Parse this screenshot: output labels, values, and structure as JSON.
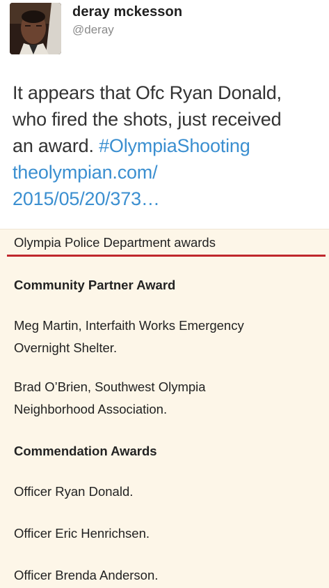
{
  "tweet": {
    "display_name": "deray mckesson",
    "handle": "@deray",
    "text_lines": [
      "It appears that Ofc Ryan Donald,",
      "who fired the shots, just received",
      "an award. "
    ],
    "hashtag": "#OlympiaShooting",
    "link_lines": [
      "theolympian.com/",
      "2015/05/20/373…"
    ]
  },
  "article": {
    "title": "Olympia Police Department awards",
    "sections": [
      {
        "heading": "Community Partner Award"
      },
      {
        "entry": [
          "Meg Martin, Interfaith Works Emergency",
          "Overnight Shelter."
        ]
      },
      {
        "entry": [
          "Brad O’Brien, Southwest Olympia",
          "Neighborhood Association."
        ]
      },
      {
        "heading": "Commendation Awards"
      },
      {
        "entry": [
          "Officer Ryan Donald."
        ]
      },
      {
        "entry": [
          "Officer Eric Henrichsen."
        ]
      },
      {
        "entry": [
          "Officer Brenda Anderson."
        ]
      }
    ]
  },
  "colors": {
    "link": "#3b8fd0",
    "rule": "#c0282d",
    "article_bg": "#fdf6e8"
  }
}
